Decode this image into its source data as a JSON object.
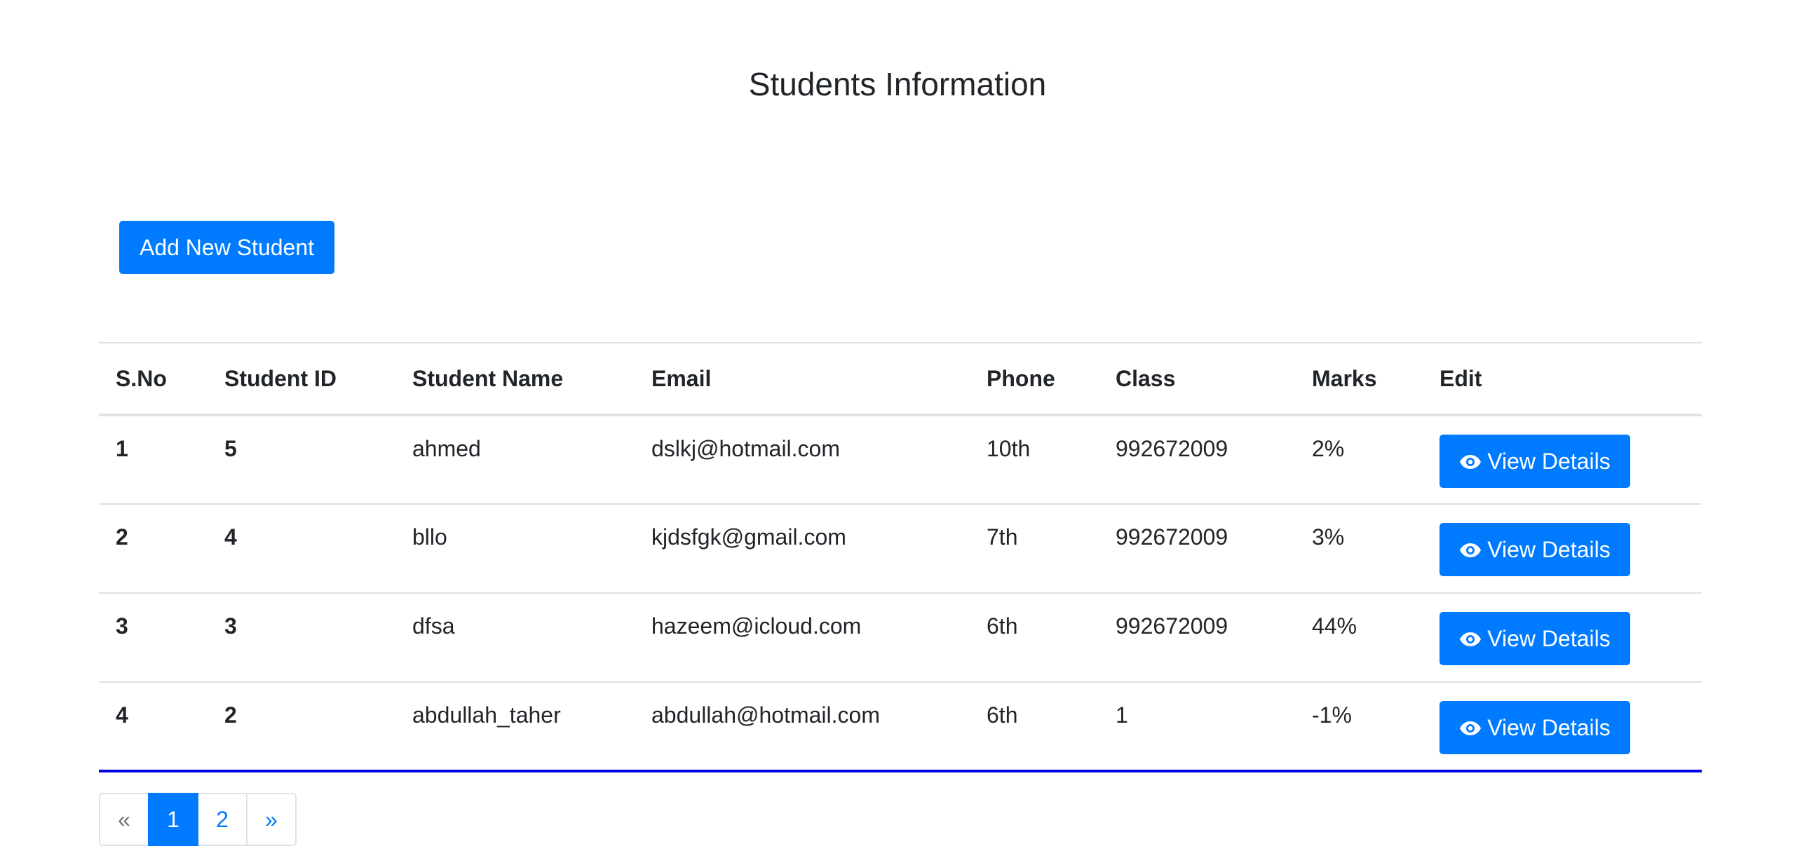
{
  "page": {
    "title": "Students Information"
  },
  "toolbar": {
    "add_label": "Add New Student"
  },
  "table": {
    "headers": [
      "S.No",
      "Student ID",
      "Student Name",
      "Email",
      "Phone",
      "Class",
      "Marks",
      "Edit"
    ],
    "rows": [
      {
        "sno": "1",
        "id": "5",
        "name": "ahmed",
        "email": "dslkj@hotmail.com",
        "phone": "10th",
        "class": "992672009",
        "marks": "2%",
        "action": "View Details"
      },
      {
        "sno": "2",
        "id": "4",
        "name": "bllo",
        "email": "kjdsfgk@gmail.com",
        "phone": "7th",
        "class": "992672009",
        "marks": "3%",
        "action": "View Details"
      },
      {
        "sno": "3",
        "id": "3",
        "name": "dfsa",
        "email": "hazeem@icloud.com",
        "phone": "6th",
        "class": "992672009",
        "marks": "44%",
        "action": "View Details"
      },
      {
        "sno": "4",
        "id": "2",
        "name": "abdullah_taher",
        "email": "abdullah@hotmail.com",
        "phone": "6th",
        "class": "1",
        "marks": "-1%",
        "action": "View Details"
      }
    ]
  },
  "pagination": {
    "prev": "«",
    "pages": [
      "1",
      "2"
    ],
    "next": "»",
    "current": "1"
  },
  "icons": {
    "view": "eye-icon"
  },
  "colors": {
    "primary": "#007bff",
    "table_bottom_border": "#0000e6",
    "text": "#212529"
  }
}
